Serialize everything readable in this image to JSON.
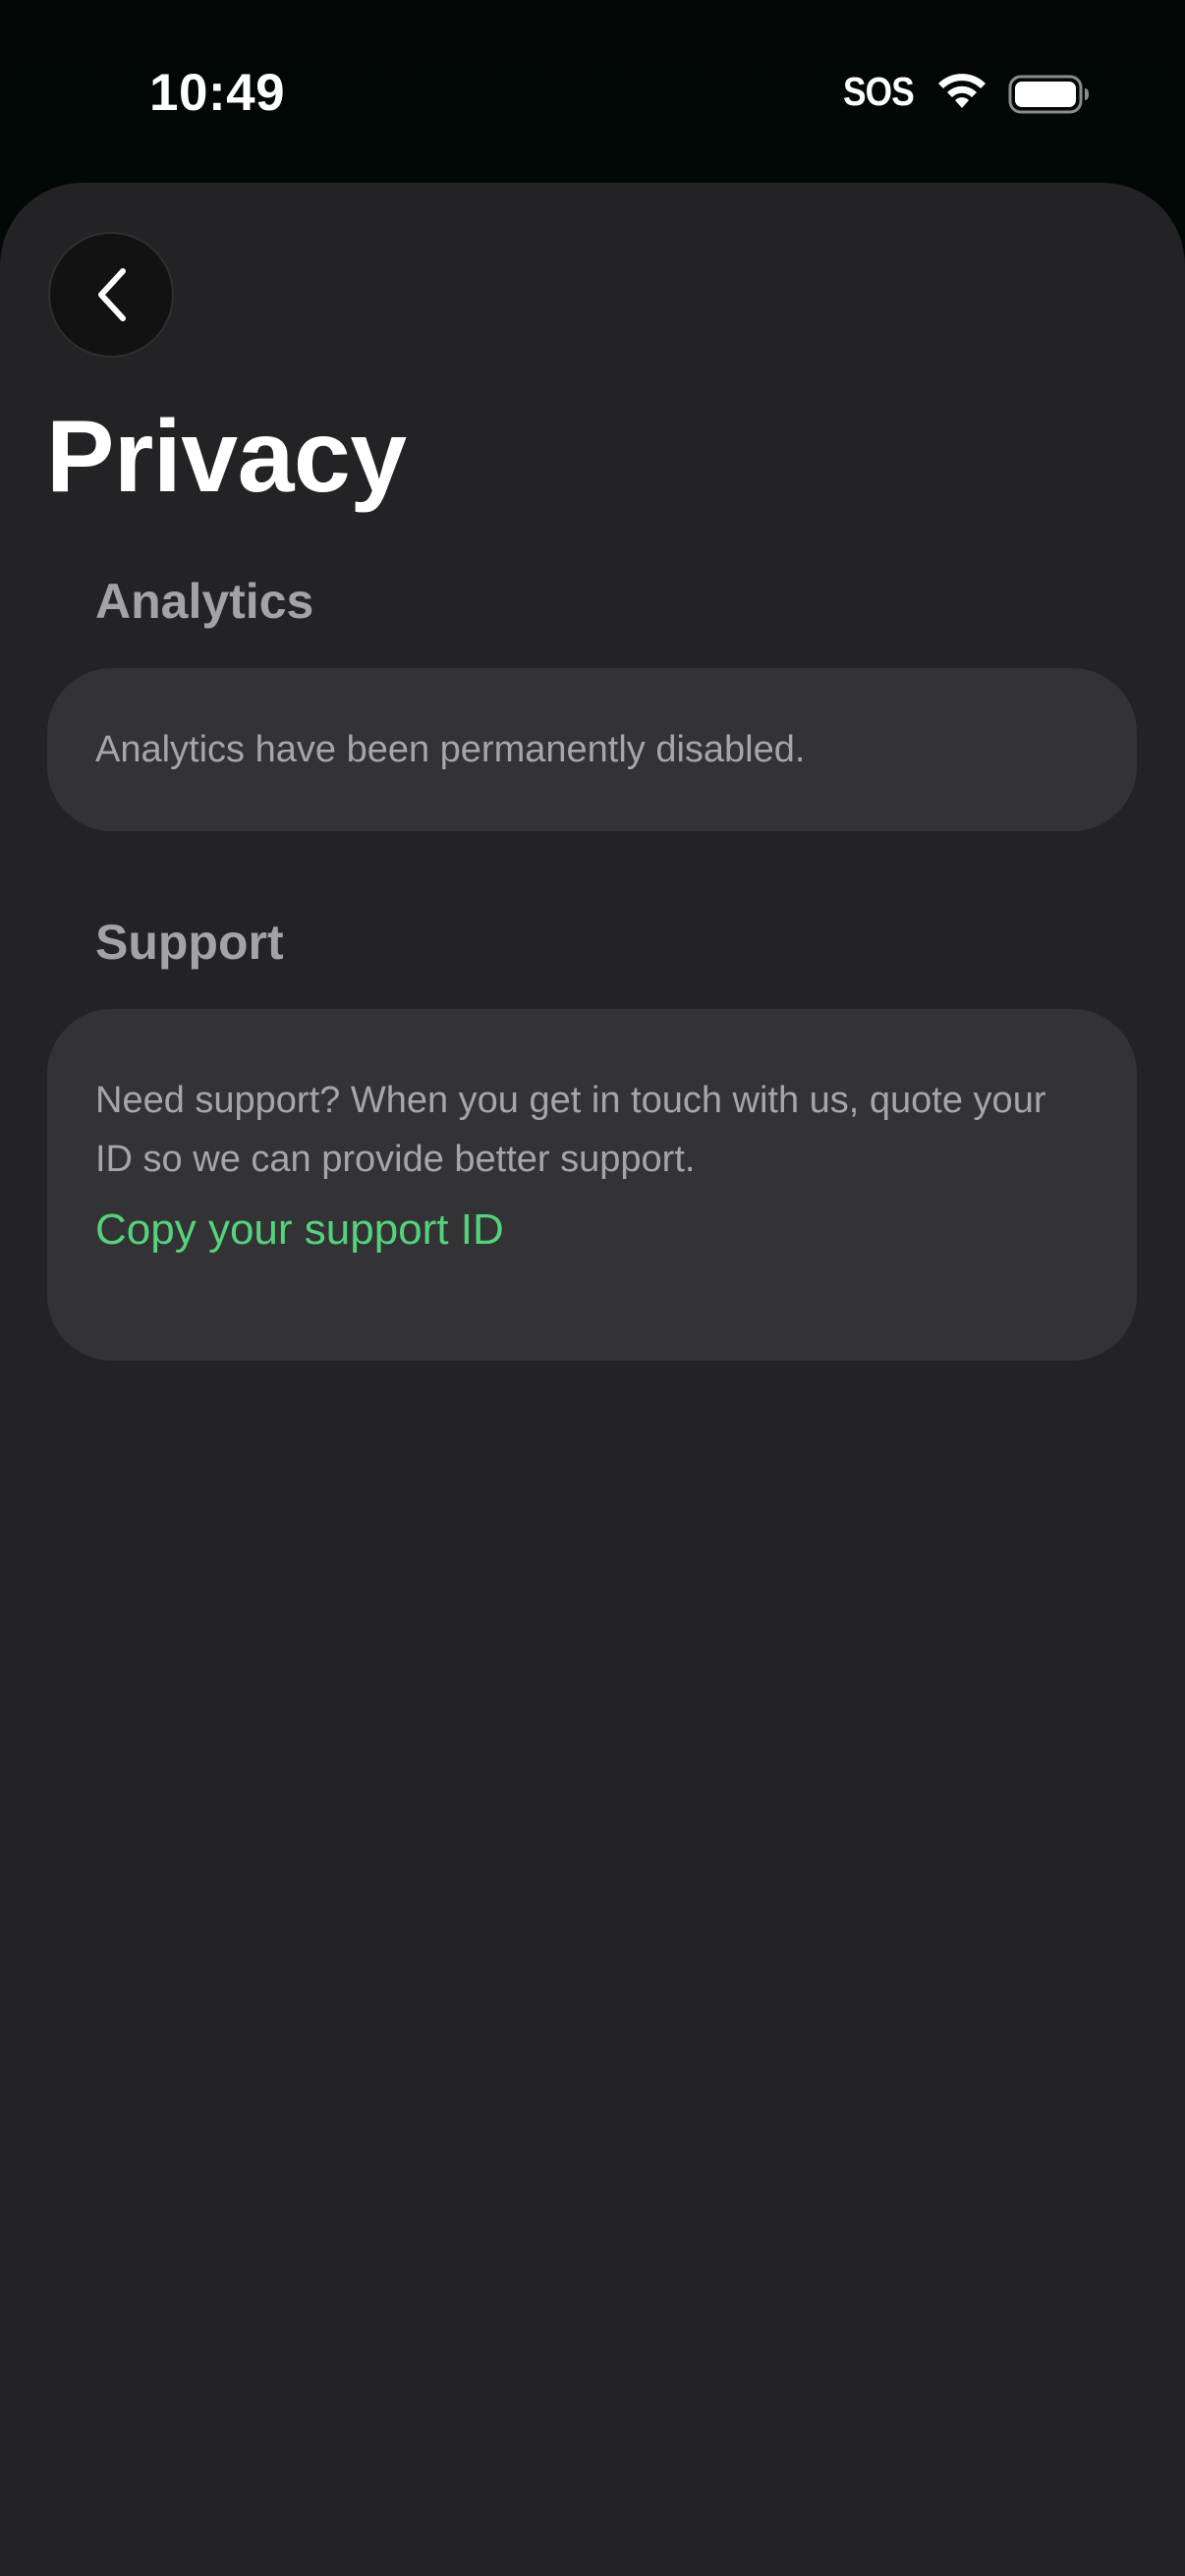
{
  "status_bar": {
    "time": "10:49",
    "sos_label": "SOS",
    "wifi_icon": "wifi-icon",
    "battery_icon": "battery-icon"
  },
  "header": {
    "back_icon": "chevron-left-icon",
    "title": "Privacy"
  },
  "sections": {
    "analytics": {
      "header": "Analytics",
      "text": "Analytics have been permanently disabled."
    },
    "support": {
      "header": "Support",
      "text": "Need support? When you get in touch with us, quote your ID so we can provide better support.",
      "link_label": "Copy your support ID"
    }
  },
  "colors": {
    "background": "#232325",
    "card": "#333336",
    "accent": "#56d27c",
    "title": "#ffffff",
    "secondary_text": "#a5a5aa"
  }
}
